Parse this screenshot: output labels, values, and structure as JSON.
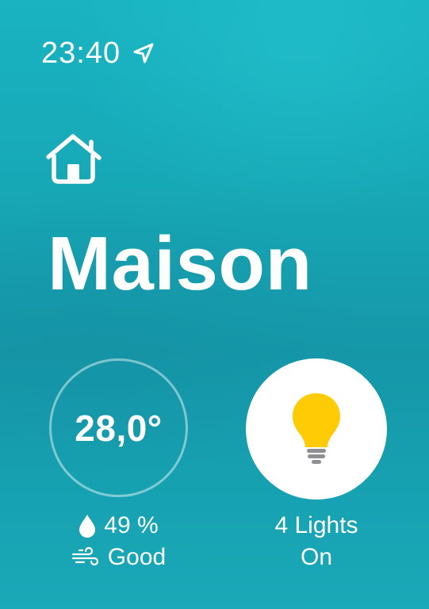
{
  "status_bar": {
    "time": "23:40",
    "location_icon": "location-arrow-icon"
  },
  "header": {
    "icon": "home-icon",
    "title": "Maison"
  },
  "climate": {
    "temperature": "28,0°",
    "humidity": {
      "icon": "water-drop-icon",
      "value": "49 %"
    },
    "air_quality": {
      "icon": "wind-icon",
      "value": "Good"
    }
  },
  "lights": {
    "icon": "lightbulb-icon",
    "count_label": "4 Lights",
    "state_label": "On"
  },
  "colors": {
    "background": "#17a8b6",
    "bulb_yellow": "#FFCB05",
    "bulb_base": "#8E8E93",
    "foreground": "#FFFFFF"
  }
}
